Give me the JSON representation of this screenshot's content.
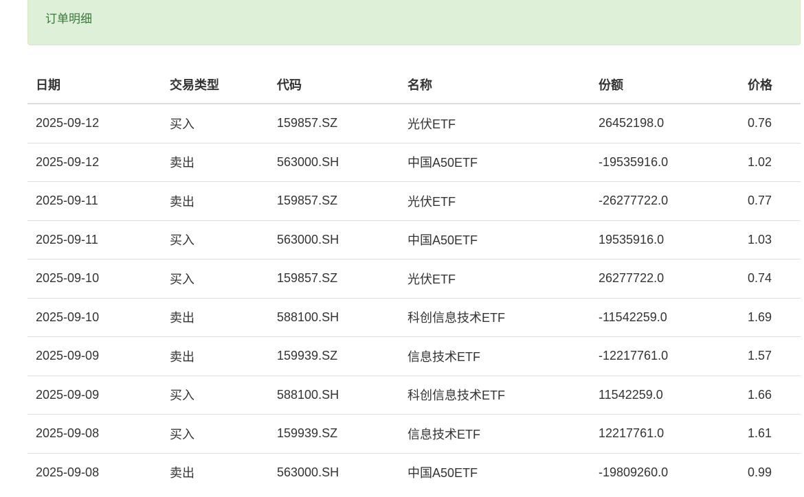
{
  "panel": {
    "title": "订单明细"
  },
  "table": {
    "headers": {
      "date": "日期",
      "type": "交易类型",
      "code": "代码",
      "name": "名称",
      "quantity": "份额",
      "price": "价格"
    },
    "rows": [
      {
        "date": "2025-09-12",
        "type": "买入",
        "code": "159857.SZ",
        "name": "光伏ETF",
        "quantity": "26452198.0",
        "price": "0.76"
      },
      {
        "date": "2025-09-12",
        "type": "卖出",
        "code": "563000.SH",
        "name": "中国A50ETF",
        "quantity": "-19535916.0",
        "price": "1.02"
      },
      {
        "date": "2025-09-11",
        "type": "卖出",
        "code": "159857.SZ",
        "name": "光伏ETF",
        "quantity": "-26277722.0",
        "price": "0.77"
      },
      {
        "date": "2025-09-11",
        "type": "买入",
        "code": "563000.SH",
        "name": "中国A50ETF",
        "quantity": "19535916.0",
        "price": "1.03"
      },
      {
        "date": "2025-09-10",
        "type": "买入",
        "code": "159857.SZ",
        "name": "光伏ETF",
        "quantity": "26277722.0",
        "price": "0.74"
      },
      {
        "date": "2025-09-10",
        "type": "卖出",
        "code": "588100.SH",
        "name": "科创信息技术ETF",
        "quantity": "-11542259.0",
        "price": "1.69"
      },
      {
        "date": "2025-09-09",
        "type": "卖出",
        "code": "159939.SZ",
        "name": "信息技术ETF",
        "quantity": "-12217761.0",
        "price": "1.57"
      },
      {
        "date": "2025-09-09",
        "type": "买入",
        "code": "588100.SH",
        "name": "科创信息技术ETF",
        "quantity": "11542259.0",
        "price": "1.66"
      },
      {
        "date": "2025-09-08",
        "type": "买入",
        "code": "159939.SZ",
        "name": "信息技术ETF",
        "quantity": "12217761.0",
        "price": "1.61"
      },
      {
        "date": "2025-09-08",
        "type": "卖出",
        "code": "563000.SH",
        "name": "中国A50ETF",
        "quantity": "-19809260.0",
        "price": "0.99"
      }
    ]
  },
  "colors": {
    "panel_background": "#dff0d8",
    "panel_border": "#d6e9c6",
    "panel_title": "#3c763d",
    "row_divider": "#dddddd",
    "text": "#333333"
  }
}
